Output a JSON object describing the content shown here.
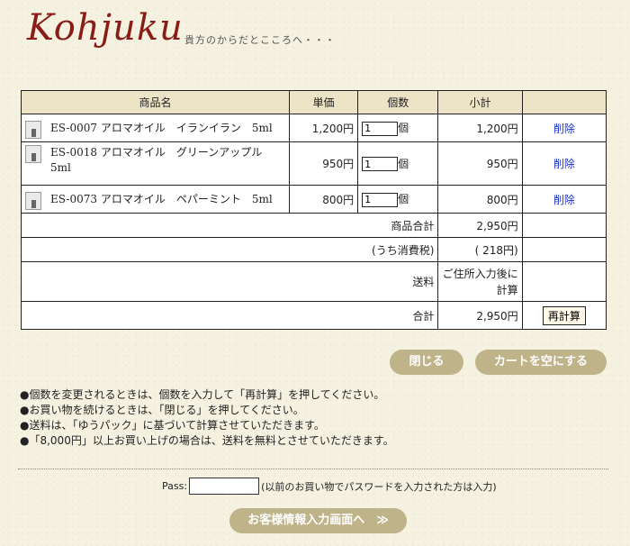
{
  "header": {
    "logo": "Kohjuku",
    "tagline": "貴方のからだとこころへ・・・"
  },
  "table": {
    "headers": {
      "product": "商品名",
      "unit_price": "単価",
      "quantity": "個数",
      "subtotal": "小計"
    },
    "rows": [
      {
        "name": "ES-0007 アロマオイル　イランイラン　5ml",
        "price": "1,200円",
        "qty": "1",
        "unit": "個",
        "subtotal": "1,200円",
        "delete": "削除"
      },
      {
        "name": "ES-0018 アロマオイル　グリーンアップル　5ml",
        "price": "950円",
        "qty": "1",
        "unit": "個",
        "subtotal": "950円",
        "delete": "削除"
      },
      {
        "name": "ES-0073 アロマオイル　ペパーミント　5ml",
        "price": "800円",
        "qty": "1",
        "unit": "個",
        "subtotal": "800円",
        "delete": "削除"
      }
    ],
    "summary": {
      "goods_total_label": "商品合計",
      "goods_total": "2,950円",
      "tax_label": "(うち消費税)",
      "tax": "( 218円)",
      "shipping_label": "送料",
      "shipping_note": "ご住所入力後に計算",
      "total_label": "合計",
      "total": "2,950円",
      "recalc_button": "再計算"
    }
  },
  "buttons": {
    "close": "閉じる",
    "empty_cart": "カートを空にする",
    "proceed": "お客様情報入力画面へ　≫"
  },
  "notes": [
    "●個数を変更されるときは、個数を入力して「再計算」を押してください。",
    "●お買い物を続けるときは、「閉じる」を押してください。",
    "●送料は、「ゆうパック」に基づいて計算させていただきます。",
    "●「8,000円」以上お買い上げの場合は、送料を無料とさせていただきます。"
  ],
  "password": {
    "label": "Pass:",
    "value": "",
    "note": "(以前のお買い物でパスワードを入力された方は入力)"
  }
}
